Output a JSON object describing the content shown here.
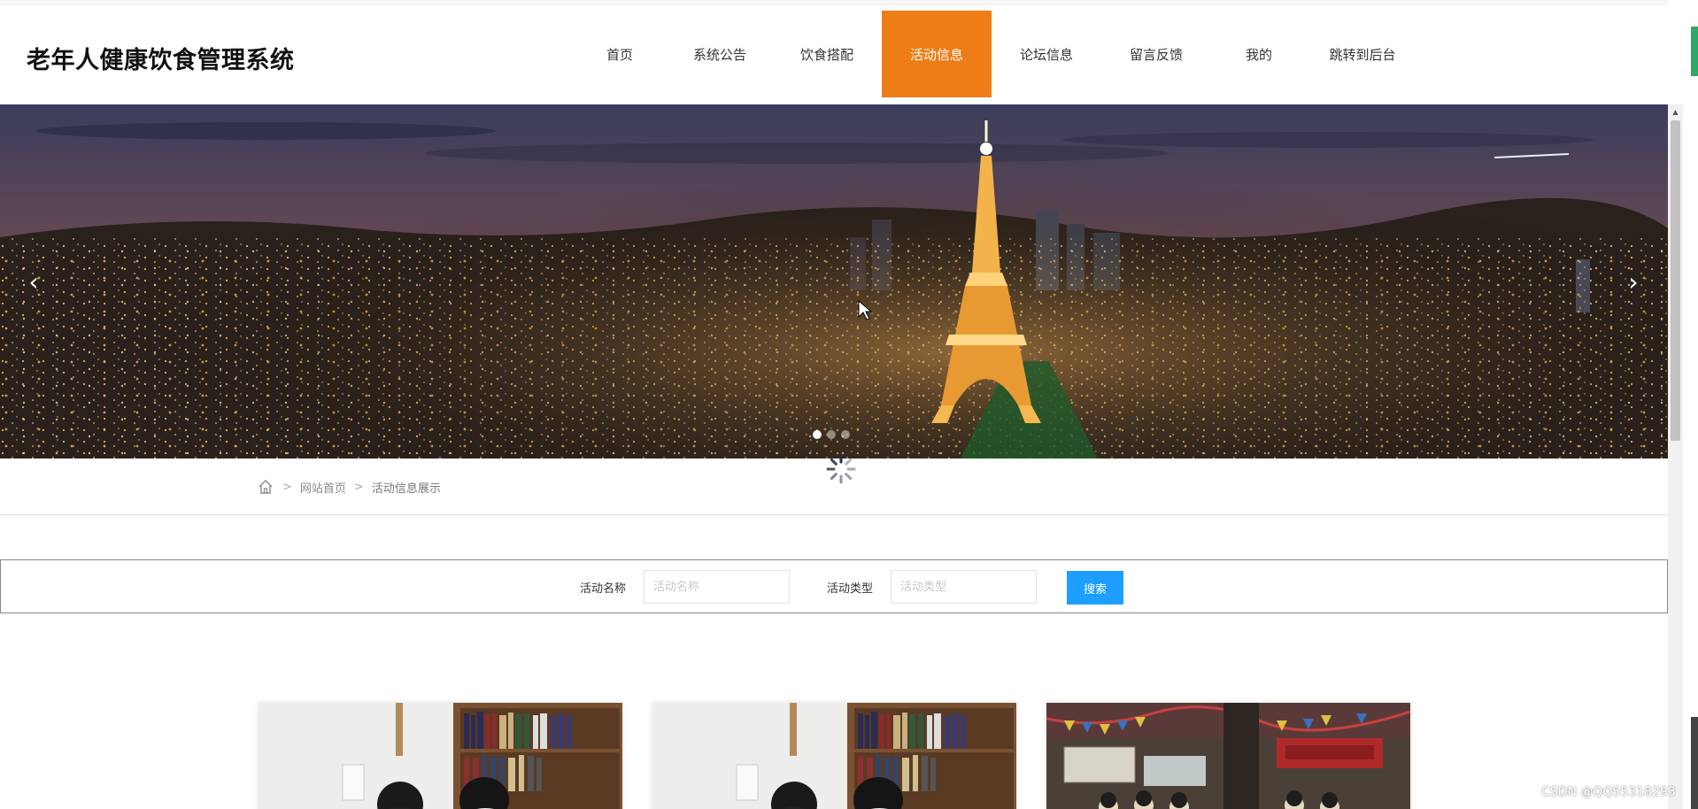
{
  "header": {
    "site_title": "老年人健康饮食管理系统",
    "nav": [
      {
        "label": "首页",
        "active": false
      },
      {
        "label": "系统公告",
        "active": false
      },
      {
        "label": "饮食搭配",
        "active": false
      },
      {
        "label": "活动信息",
        "active": true
      },
      {
        "label": "论坛信息",
        "active": false
      },
      {
        "label": "留言反馈",
        "active": false
      },
      {
        "label": "我的",
        "active": false
      },
      {
        "label": "跳转到后台",
        "active": false
      }
    ],
    "active_color": "#ee7d17"
  },
  "banner": {
    "prev_icon": "chevron-left-icon",
    "next_icon": "chevron-right-icon",
    "slide_count": 3,
    "active_slide": 1
  },
  "breadcrumb": {
    "home_icon": "home-icon",
    "items": [
      "网站首页",
      "活动信息展示"
    ]
  },
  "search": {
    "name_label": "活动名称",
    "name_placeholder": "活动名称",
    "type_label": "活动类型",
    "type_placeholder": "活动类型",
    "button_label": "搜索",
    "button_color": "#1e9fff"
  },
  "cards": [
    {
      "scene": "library-study"
    },
    {
      "scene": "library-study"
    },
    {
      "scene": "temple-group"
    }
  ],
  "watermark": "CSDN @QQ55318293"
}
